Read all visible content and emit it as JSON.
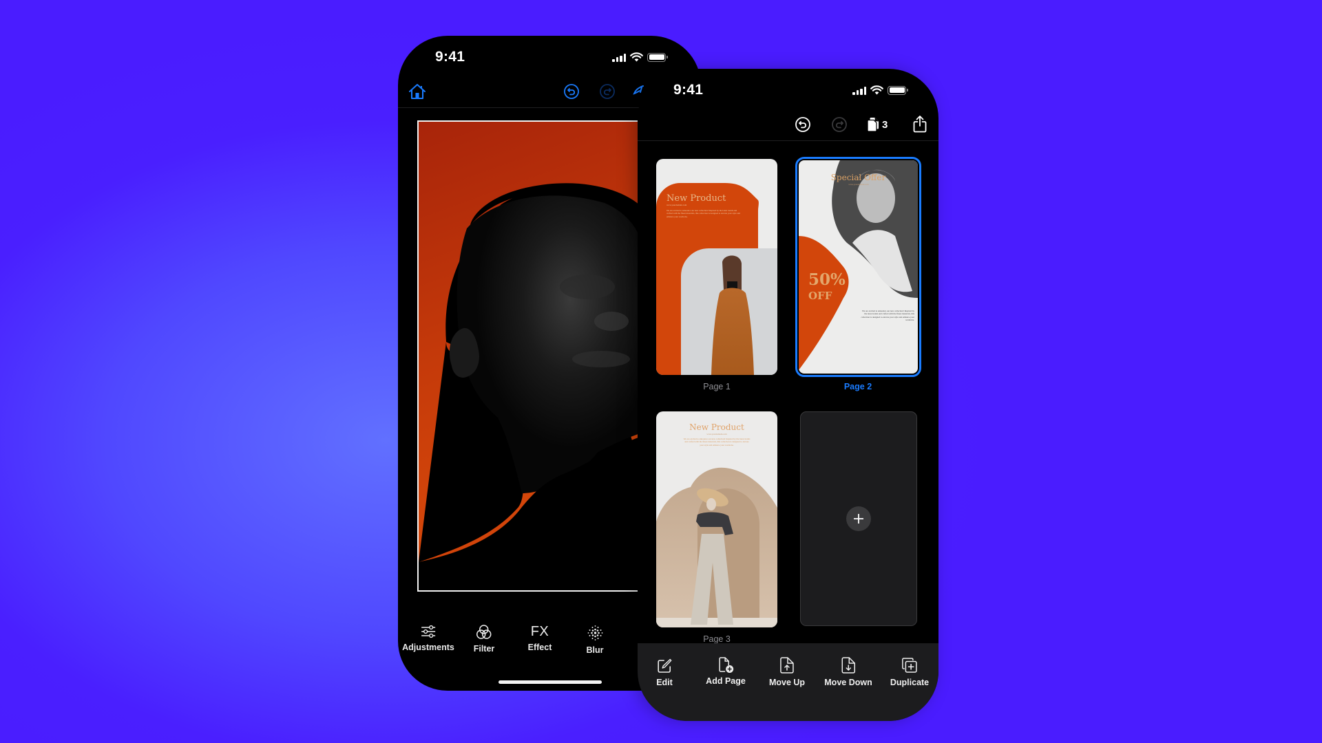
{
  "colors": {
    "background": "#4a1cff",
    "accent": "#1a7cff",
    "brand_orange": "#d2460b",
    "gold_text": "#e0a36a",
    "toolbar_bg": "#1c1c1e"
  },
  "left_phone": {
    "status_bar": {
      "time": "9:41",
      "icons": [
        "cellular-signal-icon",
        "wifi-icon",
        "battery-icon"
      ]
    },
    "nav": {
      "home": "home-icon",
      "undo": "undo-icon",
      "redo": "redo-icon",
      "overflow": "brush-icon"
    },
    "canvas": {
      "image": "Portrait of a man on an orange background"
    },
    "toolbar": [
      {
        "label": "Adjustments",
        "icon": "sliders-icon"
      },
      {
        "label": "Filter",
        "icon": "filter-circles-icon"
      },
      {
        "label": "Effect",
        "icon": "fx-icon",
        "glyph": "FX"
      },
      {
        "label": "Blur",
        "icon": "blur-dots-icon"
      }
    ]
  },
  "right_phone": {
    "status_bar": {
      "time": "9:41",
      "icons": [
        "cellular-signal-icon",
        "wifi-icon",
        "battery-icon"
      ]
    },
    "header": {
      "undo": "undo-icon",
      "redo": "redo-icon",
      "page_count": "3",
      "share": "share-icon"
    },
    "pages": [
      {
        "label": "Page 1",
        "selected": false,
        "title": "New Product",
        "subtitle": "www.yourdomain.com",
        "body": "We are excited to announce our new collection! Inspired by the latest trends and crafted with the finest materials, this collection is designed to elevate your style and enhance your wardrobe."
      },
      {
        "label": "Page 2",
        "selected": true,
        "title": "Special Offer",
        "subtitle": "www.yourdomain.com",
        "discount": "50%",
        "discount_suffix": "OFF",
        "body": "We are excited to announce our new collection! Inspired by the latest trends and crafted with the finest materials, this collection is designed to elevate your style and enhance your wardrobe."
      },
      {
        "label": "Page 3",
        "selected": false,
        "title": "New Product",
        "subtitle": "www.yourdomain.com",
        "body": "We are excited to announce our new collection! Inspired by the latest trends and crafted with the finest materials, this collection is designed to elevate your style and enhance your wardrobe."
      }
    ],
    "add_page_tile": {
      "icon": "plus-icon"
    },
    "toolbar": [
      {
        "label": "Edit",
        "icon": "edit-icon"
      },
      {
        "label": "Add Page",
        "icon": "add-page-icon"
      },
      {
        "label": "Move Up",
        "icon": "move-up-icon"
      },
      {
        "label": "Move Down",
        "icon": "move-down-icon"
      },
      {
        "label": "Duplicate",
        "icon": "duplicate-icon"
      }
    ]
  }
}
